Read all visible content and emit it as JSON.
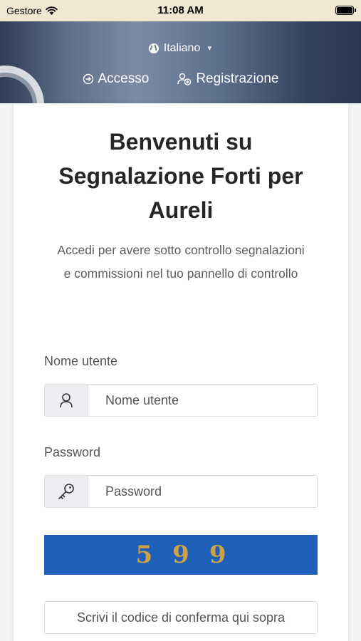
{
  "status_bar": {
    "carrier": "Gestore",
    "time": "11:08 AM"
  },
  "header": {
    "language": "Italiano",
    "nav": {
      "login": "Accesso",
      "register": "Registrazione"
    }
  },
  "main": {
    "title": "Benvenuti su Segnalazione Forti per Aureli",
    "subtitle": "Accedi per avere sotto controllo segnalazioni e commissioni nel tuo pannello di controllo",
    "username": {
      "label": "Nome utente",
      "placeholder": "Nome utente"
    },
    "password": {
      "label": "Password",
      "placeholder": "Password"
    },
    "captcha": {
      "digits": [
        "5",
        "9",
        "9"
      ]
    },
    "confirm_code": {
      "placeholder": "Scrivi il codice di conferma qui sopra"
    }
  },
  "colors": {
    "captcha_bg": "#1e5fb8",
    "captcha_digits": "#c9a24a",
    "status_bar_bg": "#f0e6d2"
  }
}
